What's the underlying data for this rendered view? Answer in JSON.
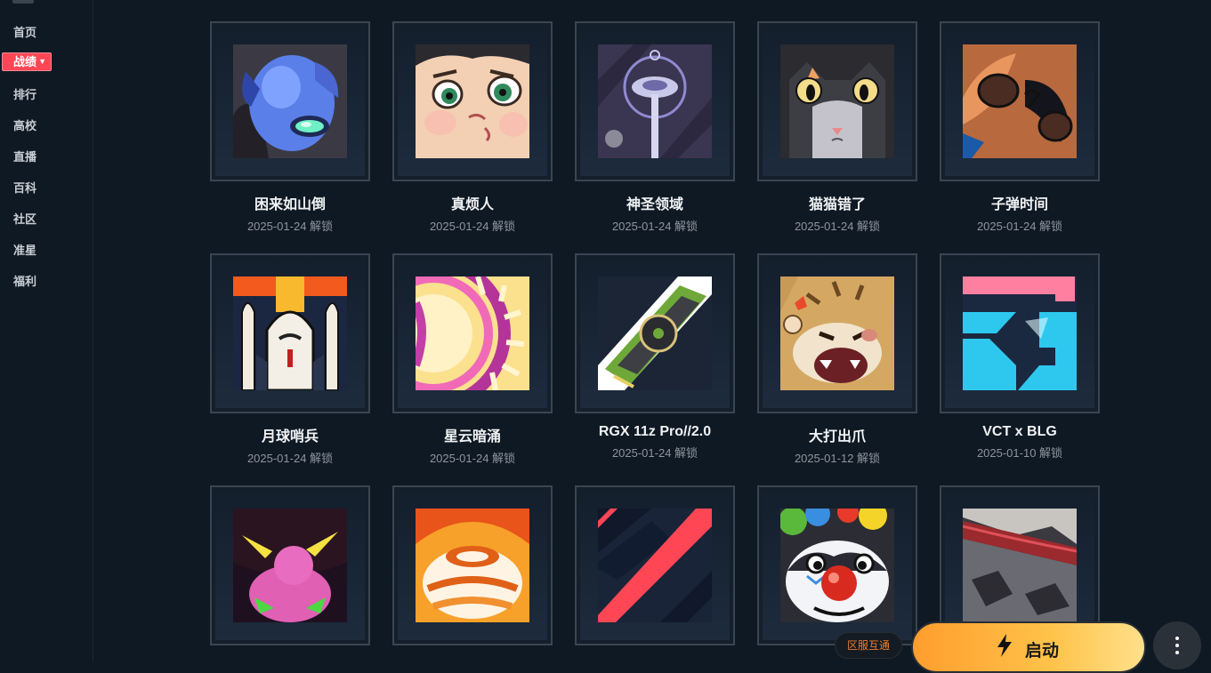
{
  "sidebar": {
    "items": [
      {
        "label": "首页"
      },
      {
        "label": "战绩",
        "active": true
      },
      {
        "label": "排行"
      },
      {
        "label": "高校"
      },
      {
        "label": "直播"
      },
      {
        "label": "百科"
      },
      {
        "label": "社区"
      },
      {
        "label": "准星"
      },
      {
        "label": "福利"
      }
    ]
  },
  "cards": [
    {
      "name": "困来如山倒",
      "date": "2025-01-24 解锁",
      "icon": "blue-robot-sleepy-icon"
    },
    {
      "name": "真烦人",
      "date": "2025-01-24 解锁",
      "icon": "annoyed-face-icon"
    },
    {
      "name": "神圣领域",
      "date": "2025-01-24 解锁",
      "icon": "sacred-staff-icon"
    },
    {
      "name": "猫猫错了",
      "date": "2025-01-24 解锁",
      "icon": "sorry-cat-icon"
    },
    {
      "name": "子弹时间",
      "date": "2025-01-24 解锁",
      "icon": "bullet-time-face-icon"
    },
    {
      "name": "月球哨兵",
      "date": "2025-01-24 解锁",
      "icon": "rocket-shuttle-icon"
    },
    {
      "name": "星云暗涌",
      "date": "2025-01-24 解锁",
      "icon": "nebula-swirl-icon"
    },
    {
      "name": "RGX 11z Pro//2.0",
      "date": "2025-01-24 解锁",
      "icon": "graphics-card-icon"
    },
    {
      "name": "大打出爪",
      "date": "2025-01-12 解锁",
      "icon": "angry-tiger-icon"
    },
    {
      "name": "VCT x BLG",
      "date": "2025-01-10 解锁",
      "icon": "blg-logo-icon"
    },
    {
      "name": "",
      "date": "",
      "icon": "pink-blob-monster-icon"
    },
    {
      "name": "",
      "date": "",
      "icon": "orange-mask-icon"
    },
    {
      "name": "",
      "date": "",
      "icon": "chevron-stripe-icon"
    },
    {
      "name": "",
      "date": "",
      "icon": "clown-face-icon"
    },
    {
      "name": "",
      "date": "",
      "icon": "cake-slice-icon"
    }
  ],
  "bottom": {
    "server_tag": "区服互通",
    "launch_label": "启动",
    "launch_icon": "lightning-bolt-icon",
    "more_icon": "more-vertical-icon"
  },
  "colors": {
    "background": "#0f1923",
    "active_tab": "#ff4655",
    "launch_gradient_start": "#ff9d2e",
    "launch_gradient_end": "#ffe08a",
    "server_tag_text": "#f07c2f"
  }
}
